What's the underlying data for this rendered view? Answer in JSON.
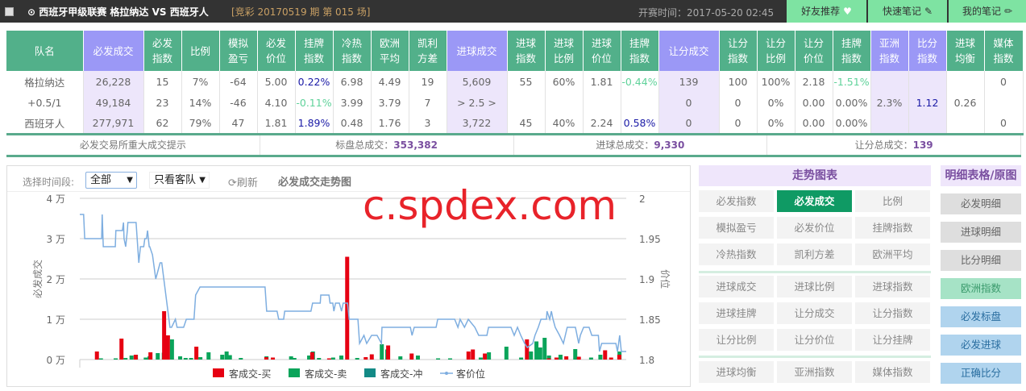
{
  "header": {
    "title": "⊙ 西班牙甲级联赛  格拉纳达  VS 西班牙人",
    "issue": "[竞彩 20170519 期 第 015 场]",
    "start_time": "开赛时间：2017-05-20 02:45",
    "buttons": [
      {
        "label": "好友推荐",
        "icon": "heart-icon"
      },
      {
        "label": "快速笔记",
        "icon": "edit-icon"
      },
      {
        "label": "我的笔记",
        "icon": "pencil-icon"
      }
    ]
  },
  "table": {
    "headers": [
      "队名",
      "必发成交",
      "必发\n指数",
      "比例",
      "模拟\n盈亏",
      "必发\n价位",
      "挂牌\n指数",
      "冷热\n指数",
      "欧洲\n平均",
      "凯利\n方差",
      "进球成交",
      "进球\n指数",
      "进球\n比例",
      "进球\n价位",
      "挂牌\n指数",
      "让分成交",
      "让分\n指数",
      "让分\n比例",
      "让分\n价位",
      "挂牌\n指数",
      "亚洲\n指数",
      "比分\n指数",
      "进球\n均衡",
      "媒体\n指数"
    ],
    "rows": [
      [
        "格拉纳达",
        "26,228",
        "15",
        "7%",
        "-64",
        "5.00",
        "0.22%",
        "6.98",
        "4.49",
        "19",
        "5,609",
        "55",
        "60%",
        "1.81",
        "-0.44%",
        "139",
        "100",
        "100%",
        "2.18",
        "-1.51%",
        "",
        "",
        "",
        "0"
      ],
      [
        "+0.5/1",
        "49,184",
        "23",
        "14%",
        "-46",
        "4.10",
        "-0.11%",
        "3.99",
        "3.79",
        "7",
        "> 2.5 >",
        "",
        "",
        "",
        "",
        "0",
        "0",
        "0%",
        "0.00",
        "0.00%",
        "2.3%",
        "1.12",
        "0.26",
        ""
      ],
      [
        "西班牙人",
        "277,971",
        "62",
        "79%",
        "47",
        "1.81",
        "1.89%",
        "0.48",
        "1.76",
        "3",
        "3,722",
        "45",
        "40%",
        "2.24",
        "0.58%",
        "0",
        "0",
        "0%",
        "0.00",
        "0.00%",
        "",
        "",
        "",
        "0"
      ]
    ]
  },
  "summary": {
    "hint": "必发交易所重大成交提示",
    "items": [
      {
        "label": "标盘总成交：",
        "value": "353,382"
      },
      {
        "label": "进球总成交：",
        "value": "9,330"
      },
      {
        "label": "让分总成交：",
        "value": "139"
      }
    ]
  },
  "controls": {
    "period_label": "选择时间段:",
    "period_value": "全部",
    "team_value": "只看客队",
    "refresh_label": "刷新",
    "chart_title": "必发成交走势图"
  },
  "watermark": "c.spdex.com",
  "trend_panel": {
    "title": "走势图表",
    "groups": [
      [
        "必发指数",
        "必发成交",
        "比例",
        "模拟盈亏",
        "必发价位",
        "挂牌指数",
        "冷热指数",
        "凯利方差",
        "欧洲平均"
      ],
      [
        "进球成交",
        "进球比例",
        "进球指数",
        "进球挂牌",
        "让分成交",
        "让分指数",
        "让分比例",
        "让分价位",
        "让分挂牌"
      ],
      [
        "进球均衡",
        "亚洲指数",
        "媒体指数"
      ]
    ],
    "active": "必发成交"
  },
  "detail_panel": {
    "title": "明细表格/原图",
    "buttons": [
      {
        "label": "必发明细",
        "style": "gray"
      },
      {
        "label": "进球明细",
        "style": "gray"
      },
      {
        "label": "比分明细",
        "style": "gray"
      },
      {
        "label": "欧洲指数",
        "style": "green"
      },
      {
        "label": "必发标盘",
        "style": "blue"
      },
      {
        "label": "必发进球",
        "style": "blue"
      },
      {
        "label": "正确比分",
        "style": "blue"
      }
    ]
  },
  "chart_data": {
    "type": "bar+line",
    "title": "必发成交走势图",
    "ylabel": "必发成交",
    "y2label": "价位",
    "ylim": [
      0,
      40000
    ],
    "y2lim": [
      1.8,
      2.0
    ],
    "yticks": [
      "0 万",
      "1 万",
      "2 万",
      "3 万",
      "4 万"
    ],
    "y2ticks": [
      "1.8",
      "1.85",
      "1.9",
      "1.95",
      "2"
    ],
    "xlim": [
      0,
      100
    ],
    "grid": true,
    "legend": [
      "客成交-买",
      "客成交-卖",
      "客成交-冲",
      "客价位"
    ],
    "colors": {
      "buy": "#e60012",
      "sell": "#0aa45a",
      "chong": "#138a86",
      "price": "#7eaee0"
    },
    "bars": [
      [
        3.5,
        2000,
        300
      ],
      [
        6.2,
        0,
        300
      ],
      [
        8.0,
        5200,
        400
      ],
      [
        9.1,
        0,
        1000
      ],
      [
        9.9,
        0,
        1200
      ],
      [
        10.6,
        1200,
        0
      ],
      [
        11.7,
        0,
        500
      ],
      [
        12.4,
        0,
        800
      ],
      [
        13.3,
        1800,
        0
      ],
      [
        13.9,
        0,
        1600
      ],
      [
        15.0,
        0,
        1700
      ],
      [
        15.8,
        12000,
        0
      ],
      [
        16.5,
        6000,
        5000
      ],
      [
        18,
        0,
        800
      ],
      [
        19,
        0,
        400
      ],
      [
        20,
        0,
        400
      ],
      [
        21.7,
        3200,
        600
      ],
      [
        23.2,
        0,
        1800
      ],
      [
        25.7,
        0,
        1200
      ],
      [
        26.5,
        0,
        2000
      ],
      [
        27.1,
        0,
        1100
      ],
      [
        29.1,
        0,
        400
      ],
      [
        33.8,
        0,
        800
      ],
      [
        34.5,
        600,
        0
      ],
      [
        35.7,
        500,
        0
      ],
      [
        38.3,
        0,
        800
      ],
      [
        38.9,
        0,
        400
      ],
      [
        41.6,
        0,
        1000
      ],
      [
        42.3,
        0,
        2000
      ],
      [
        42.9,
        1800,
        0
      ],
      [
        43.4,
        0,
        400
      ],
      [
        46,
        300,
        500
      ],
      [
        47.5,
        0,
        1000
      ],
      [
        49.3,
        25500,
        0
      ],
      [
        50.4,
        0,
        400
      ],
      [
        52.7,
        600,
        0
      ],
      [
        53.8,
        1300,
        0
      ],
      [
        54.9,
        0,
        3800
      ],
      [
        55.9,
        0,
        2500
      ],
      [
        56.8,
        3500,
        0
      ],
      [
        58.3,
        0,
        800
      ],
      [
        61.1,
        1500,
        0
      ],
      [
        61.5,
        0,
        1000
      ],
      [
        65.2,
        0,
        300
      ],
      [
        67.4,
        0,
        300
      ],
      [
        71.5,
        2000,
        0
      ],
      [
        72.3,
        2500,
        0
      ],
      [
        73,
        0,
        500
      ],
      [
        74.5,
        1500,
        1800
      ],
      [
        77.7,
        0,
        3200
      ],
      [
        80.4,
        0,
        500
      ],
      [
        82.2,
        5000,
        2000
      ],
      [
        83.2,
        0,
        4500
      ],
      [
        83.9,
        0,
        3000
      ],
      [
        84.7,
        0,
        5400
      ],
      [
        85.5,
        0,
        1000
      ],
      [
        86.2,
        300,
        0
      ],
      [
        87.6,
        500,
        1200
      ],
      [
        89.4,
        800,
        0
      ],
      [
        90.3,
        0,
        2600
      ],
      [
        91.7,
        700,
        0
      ],
      [
        93.2,
        0,
        500
      ],
      [
        94.9,
        0,
        1200
      ],
      [
        96.5,
        2300,
        0
      ],
      [
        97.6,
        500,
        0
      ],
      [
        98.4,
        0,
        2000
      ],
      [
        99.1,
        1200,
        0
      ]
    ],
    "price": [
      [
        0,
        1.98
      ],
      [
        0.7,
        1.98
      ],
      [
        0.9,
        1.95
      ],
      [
        4.0,
        1.95
      ],
      [
        4.1,
        1.98
      ],
      [
        4.3,
        1.94
      ],
      [
        6.5,
        1.94
      ],
      [
        6.6,
        1.96
      ],
      [
        7.8,
        1.96
      ],
      [
        8.0,
        1.97
      ],
      [
        8.1,
        1.95
      ],
      [
        8.4,
        1.94
      ],
      [
        8.7,
        1.96
      ],
      [
        8.8,
        1.97
      ],
      [
        10.3,
        1.97
      ],
      [
        10.8,
        1.92
      ],
      [
        11.1,
        1.94
      ],
      [
        11.7,
        1.94
      ],
      [
        11.9,
        1.95
      ],
      [
        12.2,
        1.95
      ],
      [
        12.4,
        1.96
      ],
      [
        12.7,
        1.94
      ],
      [
        12.8,
        1.94
      ],
      [
        13.3,
        1.93
      ],
      [
        13.9,
        1.9
      ],
      [
        14.3,
        1.91
      ],
      [
        14.7,
        1.92
      ],
      [
        15.0,
        1.92
      ],
      [
        16.5,
        1.84
      ],
      [
        16.8,
        1.84
      ],
      [
        17.5,
        1.85
      ],
      [
        17.8,
        1.84
      ],
      [
        19.0,
        1.84
      ],
      [
        19.5,
        1.85
      ],
      [
        20.9,
        1.85
      ],
      [
        21.2,
        1.88
      ],
      [
        22.0,
        1.89
      ],
      [
        33.9,
        1.89
      ],
      [
        34.2,
        1.86
      ],
      [
        36.1,
        1.86
      ],
      [
        36.4,
        1.85
      ],
      [
        37.3,
        1.85
      ],
      [
        37.5,
        1.86
      ],
      [
        42.3,
        1.86
      ],
      [
        42.6,
        1.87
      ],
      [
        44.0,
        1.87
      ],
      [
        44.1,
        1.88
      ],
      [
        45.6,
        1.88
      ],
      [
        45.8,
        1.87
      ],
      [
        46.3,
        1.87
      ],
      [
        46.5,
        1.86
      ],
      [
        46.8,
        1.87
      ],
      [
        47.5,
        1.87
      ],
      [
        47.9,
        1.86
      ],
      [
        48.2,
        1.87
      ],
      [
        49.0,
        1.87
      ],
      [
        49.3,
        1.85
      ],
      [
        50.9,
        1.85
      ],
      [
        51.2,
        1.82
      ],
      [
        52,
        1.83
      ],
      [
        52.5,
        1.82
      ],
      [
        53.4,
        1.83
      ],
      [
        54.4,
        1.83
      ],
      [
        55.2,
        1.82
      ],
      [
        55.3,
        1.84
      ],
      [
        60.5,
        1.84
      ],
      [
        60.8,
        1.83
      ],
      [
        61.2,
        1.84
      ],
      [
        65.2,
        1.84
      ],
      [
        65.5,
        1.85
      ],
      [
        68.6,
        1.85
      ],
      [
        69.2,
        1.84
      ],
      [
        69.6,
        1.85
      ],
      [
        70.4,
        1.84
      ],
      [
        71.1,
        1.85
      ],
      [
        72.3,
        1.84
      ],
      [
        73.0,
        1.83
      ],
      [
        74.5,
        1.83
      ],
      [
        74.8,
        1.84
      ],
      [
        78.9,
        1.84
      ],
      [
        79.5,
        1.83
      ],
      [
        80.1,
        1.84
      ],
      [
        80.7,
        1.83
      ],
      [
        81.4,
        1.82
      ],
      [
        81.9,
        1.815
      ],
      [
        82.9,
        1.82
      ],
      [
        83.3,
        1.83
      ],
      [
        83.9,
        1.84
      ],
      [
        84.4,
        1.85
      ],
      [
        85.4,
        1.85
      ],
      [
        85.5,
        1.86
      ],
      [
        86.0,
        1.85
      ],
      [
        86.3,
        1.86
      ],
      [
        86.6,
        1.85
      ],
      [
        87.0,
        1.84
      ],
      [
        87.8,
        1.83
      ],
      [
        88.5,
        1.82
      ],
      [
        89.2,
        1.84
      ],
      [
        90.7,
        1.84
      ],
      [
        91.3,
        1.82
      ],
      [
        91.6,
        1.83
      ],
      [
        92.2,
        1.84
      ],
      [
        93.2,
        1.84
      ],
      [
        93.7,
        1.83
      ],
      [
        94.9,
        1.83
      ],
      [
        95.1,
        1.81
      ],
      [
        95.5,
        1.82
      ],
      [
        98.1,
        1.82
      ],
      [
        98.4,
        1.81
      ],
      [
        98.8,
        1.83
      ],
      [
        99.1,
        1.81
      ],
      [
        100,
        1.81
      ]
    ]
  }
}
